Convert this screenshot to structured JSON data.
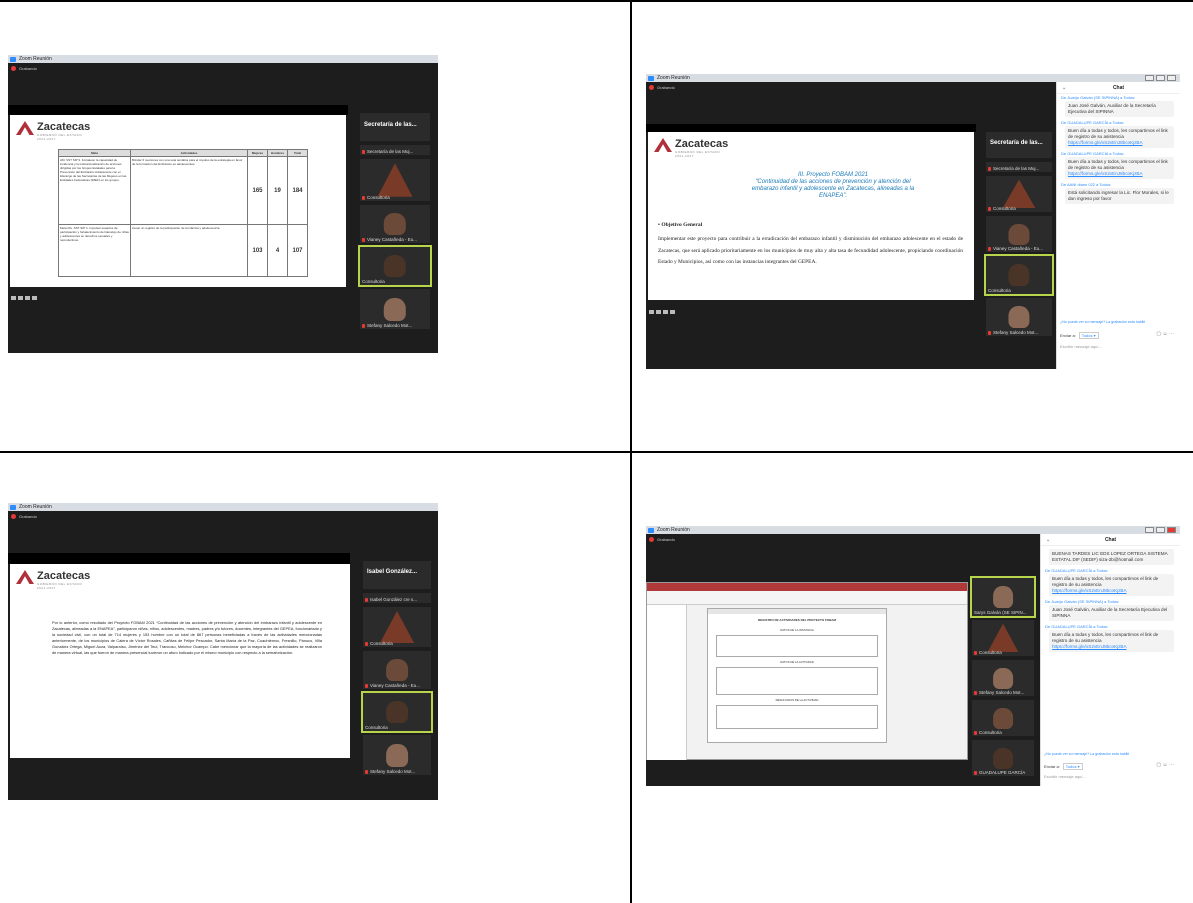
{
  "common": {
    "window_title": "Zoom Reunión",
    "recording": "Grabando",
    "logo_name": "Zacatecas",
    "logo_sub1": "GOBIERNO DEL ESTADO",
    "logo_sub2": "2021-2027",
    "colors": {
      "accent": "#2d8cff",
      "record": "#e53935",
      "brand": "#b0303a",
      "highlight": "#b7d54a"
    }
  },
  "panel1": {
    "table": {
      "headers": [
        "Meta",
        "Actividades",
        "Mujeres",
        "Hombres",
        "Total"
      ],
      "row1": {
        "meta": "AM. SST SIP 3. Fortalecer la capacidad de incidencia y la institucionalización de acciones dirigidas por los Grupos Estatales para la Prevención del Embarazo Adolescente con el liderazgo de las Secretarías de las Mujeres en las Entidades Federativas (IMEF) en los grupos.",
        "act": "Brindar 6 reuniones con una sola temática para el impulso de la estrategia en favor de la formación del Embarazo en adolescentes.",
        "m": "165",
        "h": "19",
        "t": "184"
      },
      "row2": {
        "meta": "Meta DG. SST SIP 4. Impulsar espacios de participación y fortalecimiento de liderazgo de niñas y adolescentes en derechos sexuales y reproductivos.",
        "act": "Llevar un registro de la participación de la infancia y adolescencia.",
        "m": "103",
        "h": "4",
        "t": "107"
      }
    },
    "tiles": [
      {
        "name": "Secretaría de las...",
        "big": true
      },
      {
        "name": "Secretaría de las Muj..."
      },
      {
        "name": "Consultoria"
      },
      {
        "name": "Vianey Castañeda - Eu..."
      },
      {
        "name": "Consultoria"
      },
      {
        "name": "Stefany Salcedo Mot..."
      }
    ]
  },
  "panel2": {
    "slide_title1": "III. Proyecto FOBAM 2021",
    "slide_title2": "“Continuidad de las acciones de prevención y atención del",
    "slide_title3": "embarazo infantil y adolescente en Zacatecas, alineadas a la",
    "slide_title4": "ENAPEA”.",
    "bullet": "Objetivo General",
    "body": "Implementar este proyecto para contribuir a la erradicación del embarazo infantil y disminución del embarazo adolescente en el estado de Zacatecas, que será aplicado prioritariamente en los municipios de muy alta y alta tasa de fecundidad adolescente, propiciando coordinación Estado y Municipios, así como con las instancias integrantes del GEPEA.",
    "tiles": [
      {
        "name": "Secretaría de las...",
        "big": true
      },
      {
        "name": "Secretaría de las Muj..."
      },
      {
        "name": "Consultoria"
      },
      {
        "name": "Vianey Castañeda - Eu..."
      },
      {
        "name": "Consultoria"
      },
      {
        "name": "Stefany Salcedo Mot..."
      }
    ],
    "chat": {
      "title": "Chat",
      "m0_from": "De Juanjo Galván (SE SIPINNA) a Todos:",
      "m0": "Juan José Galván, Auxiliar de la Secretaría Ejecutiva del SIPINNA",
      "m1_from": "De GUADALUPE GARCÍA a Todos:",
      "m1": "Buen día a todas y todos, les compartimos el link de registro de su asistencia",
      "m1_link": "https://forms.gle/xS2vEnJ8bcoKjzBA",
      "m2_from": "De GUADALUPE GARCÍA a Todos:",
      "m2": "Buen día a todas y todos, les compartimos el link de registro de su asistencia",
      "m2_link": "https://forms.gle/xS2vEnJ8bcoKjzBA",
      "m3_from": "De AANI diann 022 a Todos:",
      "m3": "Está solicitando ingresar la Lic. Flor Morales, si le dan ingreso por favor",
      "note": "¿No puede ver su mensaje? La grabación está habilit",
      "send_to": "Enviar a:",
      "send_target": "Todos ▾",
      "placeholder": "Escribir mensaje aquí..."
    }
  },
  "panel3": {
    "text": "Por lo anterior, como resultado del Proyecto FOBAM 2021 “Continuidad de las acciones de prevención y atención del embarazo infantil y adolescente en Zacatecas, alineadas a la ENAPEA”, participaron niñas, niños, adolescentes, madres, padres y/o tutores, docentes, integrantes del GEPEA, funcionariado y la sociedad civil, con un total de 714 mujeres y 153 hombre con un total de 867 personas beneficiadas a través de las actividades mencionadas anteriormente, de los municipios de Calera de Víctor Rosales, Cañitas de Felipe Pescador, Santa María de la Paz, Cuauhtémoc, Fresnillo, Pánuco, Villa González Ortega, Miguel Auza, Valparaíso, Jiménez del Teul, Trancoso, Melchor Ocampo. Cabe mencionar que la mayoría de las actividades se realizaron de manera virtual, las que fueron de manera presencial tuvieron un aforo indicado por el mismo municipio con respecto a la semaforización.",
    "tiles": [
      {
        "name": "Isabel González...",
        "big": true
      },
      {
        "name": "Isabel González cre s..."
      },
      {
        "name": "Consultoria"
      },
      {
        "name": "Vianey Castañeda - Eu..."
      },
      {
        "name": "Consultoria"
      },
      {
        "name": "Stefany Salcedo Mot..."
      }
    ]
  },
  "panel4": {
    "form_title": "REGISTRO DE ACTIVIDADES DEL PROYECTO FOBAM",
    "form_section1": "DATOS DE LA INSTANCIA",
    "form_section2": "DATOS DE LA ACTIVIDAD",
    "form_section3": "RESULTADOS DE LA ACTIVIDAD",
    "tiles": [
      {
        "name": "Sarys Galván (SE SIPIN..."
      },
      {
        "name": "Consultoria"
      },
      {
        "name": "Stefany Salcedo Mot..."
      },
      {
        "name": "Consultoria"
      },
      {
        "name": "GUADALUPE GARCÍA"
      }
    ],
    "chat": {
      "title": "Chat",
      "m0": "BUENAS TARDES LIC EDS LOPEZ ORTEGA SISTEMA ESTATAL DIF (SEDIF) siza-2b@hotmail.com",
      "m1_from": "De GUADALUPE GARCÍA a Todos:",
      "m1": "Buen día a todas y todos, les compartimos el link de registro de su asistencia",
      "m1_link": "https://forms.gle/xS2vEnJ8bcoKjzBA",
      "m2_from": "De Juanjo Galván (SE SIPINNA) a Todos:",
      "m2": "Juan José Galván, Auxiliar de la Secretaría Ejecutiva del SIPINNA",
      "m3_from": "De GUADALUPE GARCÍA a Todos:",
      "m3": "Buen día a todas y todos, les compartimos el link de registro de su asistencia",
      "m3_link": "https://forms.gle/xS2vEnJ8bcoKjzBA",
      "note": "¿No puede ver su mensaje? La grabación está habilit",
      "send_to": "Enviar a:",
      "send_target": "Todos ▾",
      "placeholder": "Escribir mensaje aquí..."
    }
  }
}
